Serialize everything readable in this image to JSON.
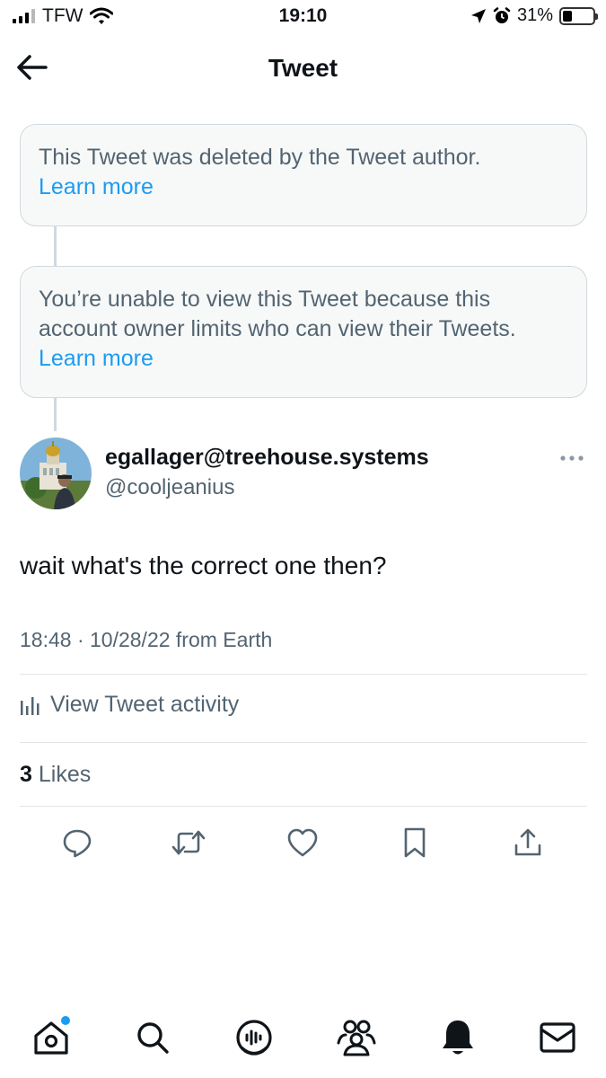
{
  "status_bar": {
    "carrier": "TFW",
    "time": "19:10",
    "battery": "31%",
    "battery_level": 0.31
  },
  "header": {
    "title": "Tweet"
  },
  "notices": [
    {
      "text": "This Tweet was deleted by the Tweet author.",
      "link": "Learn more"
    },
    {
      "text": "You’re unable to view this Tweet because this account owner limits who can view their Tweets.",
      "link": "Learn more"
    }
  ],
  "tweet": {
    "author_name": "egallager@treehouse.systems",
    "author_handle": "@cooljeanius",
    "text": "wait what's the correct one then?",
    "timestamp": "18:48 · 10/28/22 from Earth",
    "activity_label": "View Tweet activity",
    "likes_count": "3",
    "likes_label": "Likes"
  },
  "actions": [
    "reply-icon",
    "retweet-icon",
    "like-icon",
    "bookmark-icon",
    "share-icon"
  ],
  "tabs": [
    "home-icon",
    "search-icon",
    "spaces-icon",
    "communities-icon",
    "notifications-icon",
    "messages-icon"
  ],
  "colors": {
    "accent": "#1d9bf0",
    "secondary_text": "#536471",
    "card_bg": "#f7f9f9",
    "border": "#cfd9de"
  }
}
